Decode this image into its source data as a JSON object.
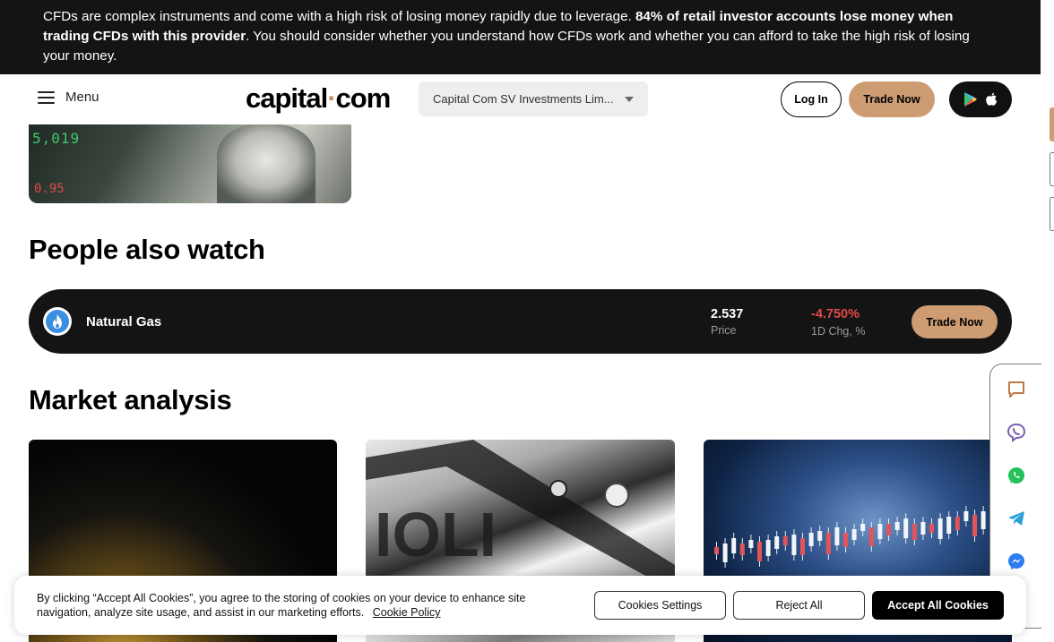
{
  "risk_banner": {
    "text_start": "CFDs are complex instruments and come with a high risk of losing money rapidly due to leverage. ",
    "text_bold": "84% of retail investor accounts lose money when trading CFDs with this provider",
    "text_end": ". You should consider whether you understand how CFDs work and whether you can afford to take the high risk of losing your money."
  },
  "header": {
    "menu_label": "Menu",
    "logo_left": "capital",
    "logo_dot": "·",
    "logo_right": "com",
    "entity_selected": "Capital Com SV Investments Lim...",
    "login_label": "Log In",
    "trade_label": "Trade Now"
  },
  "people_also_watch": {
    "title": "People also watch",
    "instrument": {
      "name": "Natural Gas",
      "price": "2.537",
      "price_label": "Price",
      "change": "-4.750%",
      "change_label": "1D Chg, %",
      "trade_label": "Trade Now",
      "change_color": "#e24949"
    }
  },
  "market_analysis": {
    "title": "Market analysis"
  },
  "cookie_banner": {
    "text": "By clicking “Accept All Cookies”, you agree to the storing of cookies on your device to enhance site navigation, analyze site usage, and assist in our marketing efforts.",
    "policy_link": "Cookie Policy",
    "settings_label": "Cookies Settings",
    "reject_label": "Reject All",
    "accept_label": "Accept All Cookies"
  },
  "thumbnail": {
    "ticker_top": "5,019",
    "ticker_bottom": "0.95"
  },
  "colors": {
    "accent": "#cd9c73",
    "banner_bg": "#141414",
    "negative": "#e24949"
  },
  "social_icons": [
    "chat-icon",
    "viber-icon",
    "whatsapp-icon",
    "telegram-icon",
    "messenger-icon"
  ]
}
